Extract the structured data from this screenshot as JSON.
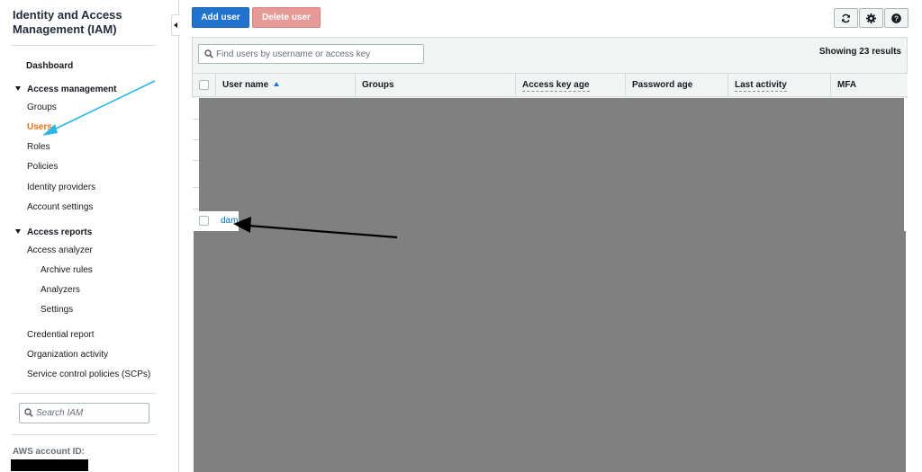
{
  "sidebar": {
    "title": "Identity and Access Management (IAM)",
    "items": [
      {
        "label": "Dashboard"
      },
      {
        "label": "Access management"
      },
      {
        "label": "Groups"
      },
      {
        "label": "Users"
      },
      {
        "label": "Roles"
      },
      {
        "label": "Policies"
      },
      {
        "label": "Identity providers"
      },
      {
        "label": "Account settings"
      },
      {
        "label": "Access reports"
      },
      {
        "label": "Access analyzer"
      },
      {
        "label": "Archive rules"
      },
      {
        "label": "Analyzers"
      },
      {
        "label": "Settings"
      },
      {
        "label": "Credential report"
      },
      {
        "label": "Organization activity"
      },
      {
        "label": "Service control policies (SCPs)"
      }
    ],
    "active_item": "Users",
    "search_placeholder": "Search IAM",
    "account_label": "AWS account ID:"
  },
  "toolbar": {
    "add_user_label": "Add user",
    "delete_user_label": "Delete user",
    "icons": [
      "refresh-icon",
      "gear-icon",
      "help-icon"
    ]
  },
  "table": {
    "search_placeholder": "Find users by username or access key",
    "showing_text": "Showing 23 results",
    "columns": [
      "User name",
      "Groups",
      "Access key age",
      "Password age",
      "Last activity",
      "MFA"
    ],
    "sort_column": "User name",
    "visible_user": "dam"
  },
  "colors": {
    "accent_blue": "#2073cf",
    "active_orange": "#ec7211",
    "link_blue": "#0073bb",
    "redaction_gray": "#808080",
    "annotation_cyan": "#2bb5e8",
    "annotation_black": "#000000"
  }
}
